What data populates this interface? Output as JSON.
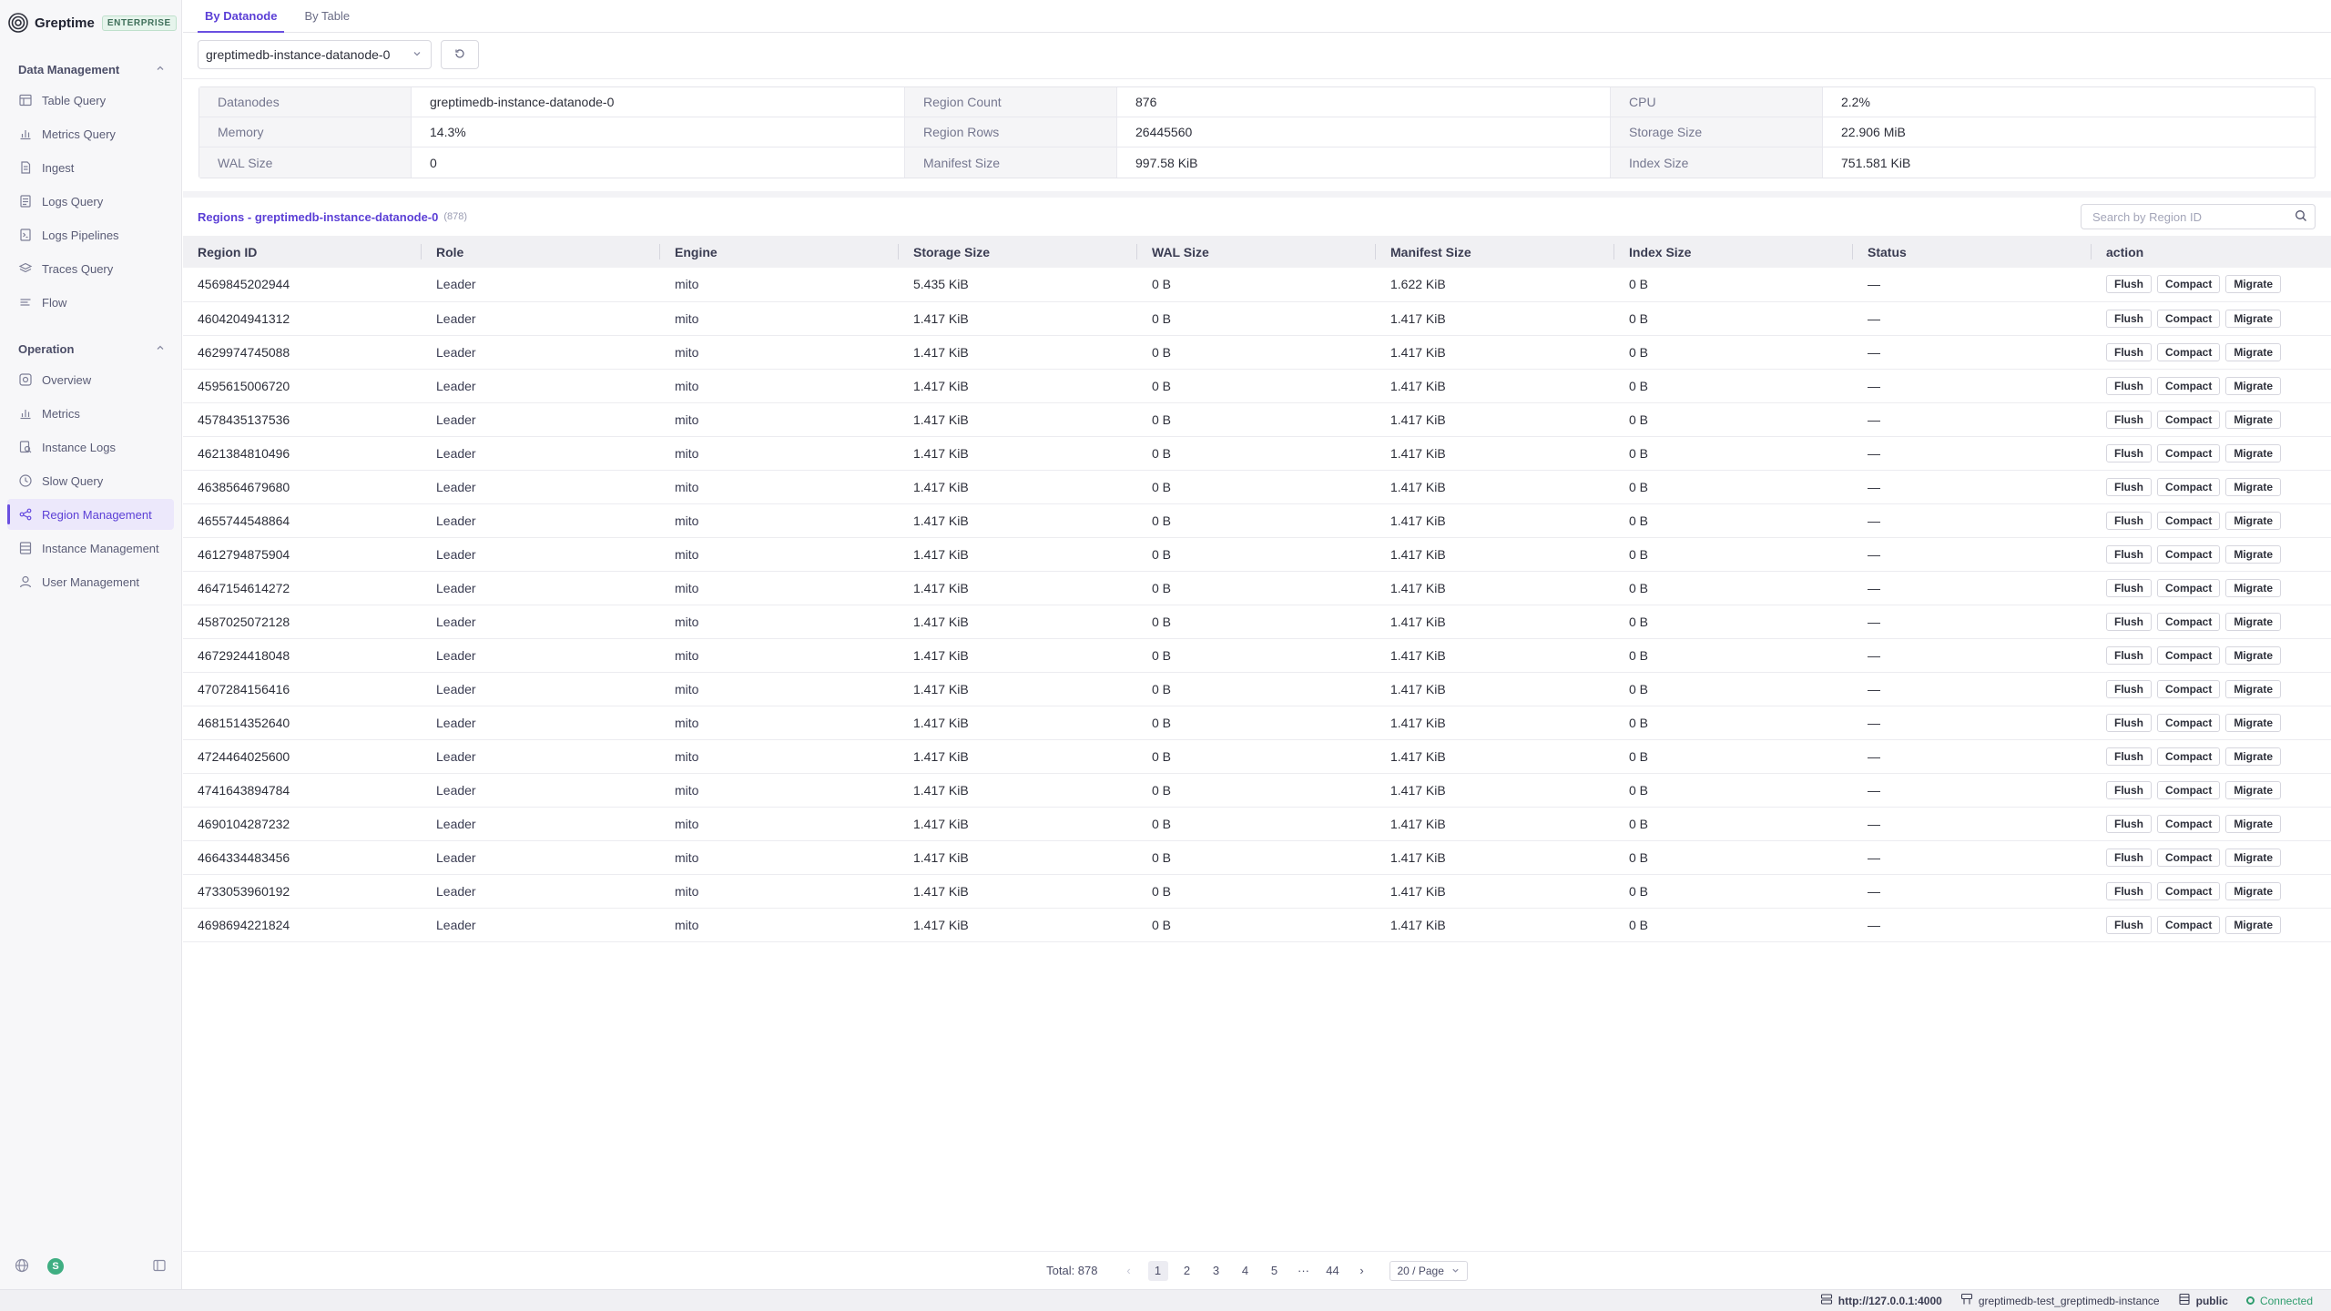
{
  "brand": {
    "name": "Greptime",
    "badge": "ENTERPRISE"
  },
  "sidebar": {
    "sections": [
      {
        "title": "Data Management",
        "items": [
          {
            "label": "Table Query",
            "icon": "table-icon"
          },
          {
            "label": "Metrics Query",
            "icon": "chart-icon"
          },
          {
            "label": "Ingest",
            "icon": "document-icon"
          },
          {
            "label": "Logs Query",
            "icon": "logs-icon"
          },
          {
            "label": "Logs Pipelines",
            "icon": "pipeline-icon"
          },
          {
            "label": "Traces Query",
            "icon": "layers-icon"
          },
          {
            "label": "Flow",
            "icon": "flow-icon"
          }
        ]
      },
      {
        "title": "Operation",
        "items": [
          {
            "label": "Overview",
            "icon": "overview-icon"
          },
          {
            "label": "Metrics",
            "icon": "chart-icon"
          },
          {
            "label": "Instance Logs",
            "icon": "logs-search-icon"
          },
          {
            "label": "Slow Query",
            "icon": "clock-icon"
          },
          {
            "label": "Region Management",
            "icon": "region-icon",
            "active": true
          },
          {
            "label": "Instance Management",
            "icon": "database-icon"
          },
          {
            "label": "User Management",
            "icon": "user-icon"
          }
        ]
      }
    ],
    "avatar": "S"
  },
  "tabs": [
    {
      "label": "By Datanode",
      "active": true
    },
    {
      "label": "By Table",
      "active": false
    }
  ],
  "datanode_select": "greptimedb-instance-datanode-0",
  "info": [
    [
      {
        "label": "Datanodes",
        "value": "greptimedb-instance-datanode-0"
      },
      {
        "label": "Region Count",
        "value": "876"
      },
      {
        "label": "CPU",
        "value": "2.2%"
      }
    ],
    [
      {
        "label": "Memory",
        "value": "14.3%"
      },
      {
        "label": "Region Rows",
        "value": "26445560"
      },
      {
        "label": "Storage Size",
        "value": "22.906 MiB"
      }
    ],
    [
      {
        "label": "WAL Size",
        "value": "0"
      },
      {
        "label": "Manifest Size",
        "value": "997.58 KiB"
      },
      {
        "label": "Index Size",
        "value": "751.581 KiB"
      }
    ]
  ],
  "regions": {
    "title": "Regions - greptimedb-instance-datanode-0",
    "count": "(878)",
    "search_placeholder": "Search by Region ID"
  },
  "table": {
    "columns": [
      "Region ID",
      "Role",
      "Engine",
      "Storage Size",
      "WAL Size",
      "Manifest Size",
      "Index Size",
      "Status",
      "action"
    ],
    "actions": [
      "Flush",
      "Compact",
      "Migrate"
    ],
    "rows": [
      [
        "4569845202944",
        "Leader",
        "mito",
        "5.435 KiB",
        "0 B",
        "1.622 KiB",
        "0 B",
        "—"
      ],
      [
        "4604204941312",
        "Leader",
        "mito",
        "1.417 KiB",
        "0 B",
        "1.417 KiB",
        "0 B",
        "—"
      ],
      [
        "4629974745088",
        "Leader",
        "mito",
        "1.417 KiB",
        "0 B",
        "1.417 KiB",
        "0 B",
        "—"
      ],
      [
        "4595615006720",
        "Leader",
        "mito",
        "1.417 KiB",
        "0 B",
        "1.417 KiB",
        "0 B",
        "—"
      ],
      [
        "4578435137536",
        "Leader",
        "mito",
        "1.417 KiB",
        "0 B",
        "1.417 KiB",
        "0 B",
        "—"
      ],
      [
        "4621384810496",
        "Leader",
        "mito",
        "1.417 KiB",
        "0 B",
        "1.417 KiB",
        "0 B",
        "—"
      ],
      [
        "4638564679680",
        "Leader",
        "mito",
        "1.417 KiB",
        "0 B",
        "1.417 KiB",
        "0 B",
        "—"
      ],
      [
        "4655744548864",
        "Leader",
        "mito",
        "1.417 KiB",
        "0 B",
        "1.417 KiB",
        "0 B",
        "—"
      ],
      [
        "4612794875904",
        "Leader",
        "mito",
        "1.417 KiB",
        "0 B",
        "1.417 KiB",
        "0 B",
        "—"
      ],
      [
        "4647154614272",
        "Leader",
        "mito",
        "1.417 KiB",
        "0 B",
        "1.417 KiB",
        "0 B",
        "—"
      ],
      [
        "4587025072128",
        "Leader",
        "mito",
        "1.417 KiB",
        "0 B",
        "1.417 KiB",
        "0 B",
        "—"
      ],
      [
        "4672924418048",
        "Leader",
        "mito",
        "1.417 KiB",
        "0 B",
        "1.417 KiB",
        "0 B",
        "—"
      ],
      [
        "4707284156416",
        "Leader",
        "mito",
        "1.417 KiB",
        "0 B",
        "1.417 KiB",
        "0 B",
        "—"
      ],
      [
        "4681514352640",
        "Leader",
        "mito",
        "1.417 KiB",
        "0 B",
        "1.417 KiB",
        "0 B",
        "—"
      ],
      [
        "4724464025600",
        "Leader",
        "mito",
        "1.417 KiB",
        "0 B",
        "1.417 KiB",
        "0 B",
        "—"
      ],
      [
        "4741643894784",
        "Leader",
        "mito",
        "1.417 KiB",
        "0 B",
        "1.417 KiB",
        "0 B",
        "—"
      ],
      [
        "4690104287232",
        "Leader",
        "mito",
        "1.417 KiB",
        "0 B",
        "1.417 KiB",
        "0 B",
        "—"
      ],
      [
        "4664334483456",
        "Leader",
        "mito",
        "1.417 KiB",
        "0 B",
        "1.417 KiB",
        "0 B",
        "—"
      ],
      [
        "4733053960192",
        "Leader",
        "mito",
        "1.417 KiB",
        "0 B",
        "1.417 KiB",
        "0 B",
        "—"
      ],
      [
        "4698694221824",
        "Leader",
        "mito",
        "1.417 KiB",
        "0 B",
        "1.417 KiB",
        "0 B",
        "—"
      ]
    ]
  },
  "pagination": {
    "total": "Total: 878",
    "pages": [
      "1",
      "2",
      "3",
      "4",
      "5",
      "···",
      "44"
    ],
    "current": "1",
    "page_size": "20 / Page"
  },
  "statusbar": {
    "url": "http://127.0.0.1:4000",
    "instance": "greptimedb-test_greptimedb-instance",
    "database": "public",
    "status": "Connected"
  },
  "colors": {
    "accent": "#6a4fe0",
    "connected": "#2f9d6e"
  }
}
